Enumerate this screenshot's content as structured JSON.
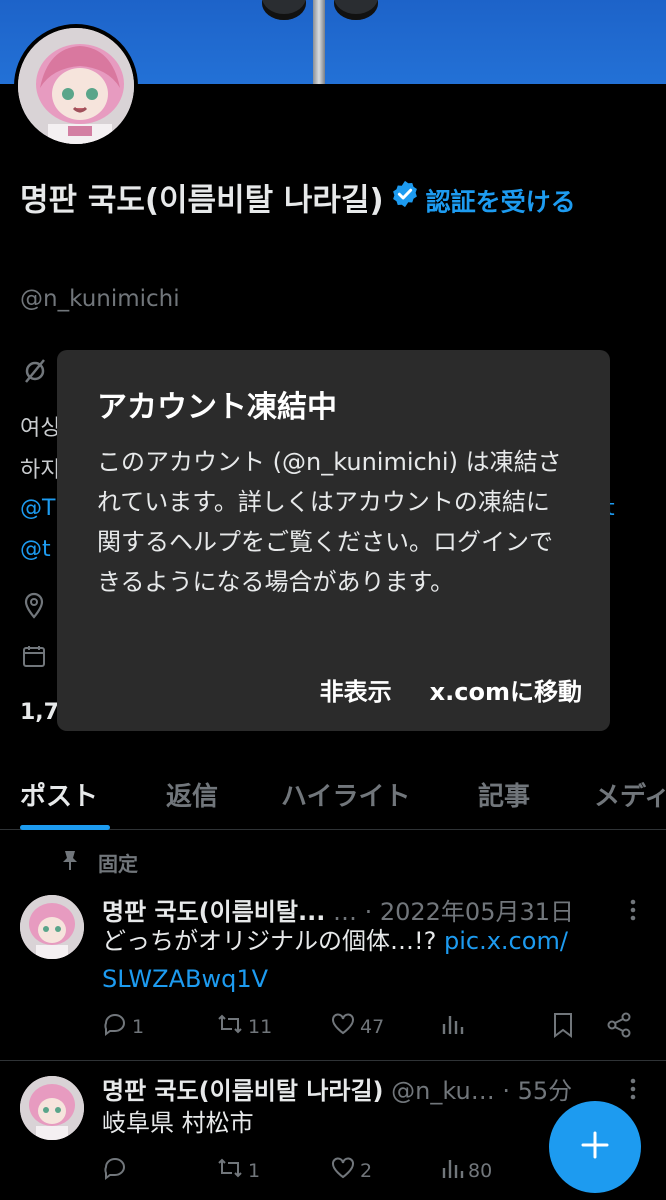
{
  "profile": {
    "display_name": "명판 국도(이름비탈 나라길)",
    "verify_link": "認証を受ける",
    "handle": "@n_kunimichi",
    "counts_fragment": "1,7",
    "bio_fragments": [
      "여싱",
      "하지"
    ],
    "link_fragments": [
      "@T",
      "@t",
      "t"
    ]
  },
  "dialog": {
    "title": "アカウント凍結中",
    "body": "このアカウント (@n_kunimichi) は凍結されています。詳しくはアカウントの凍結に関するヘルプをご覧ください。ログインできるようになる場合があります。",
    "hide_label": "非表示",
    "goto_label": "x.comに移動"
  },
  "tabs": [
    {
      "label": "ポスト",
      "active": true
    },
    {
      "label": "返信",
      "active": false
    },
    {
      "label": "ハイライト",
      "active": false
    },
    {
      "label": "記事",
      "active": false
    },
    {
      "label": "メディ",
      "active": false
    }
  ],
  "posts": [
    {
      "pinned_label": "固定",
      "name": "명판 국도(이름비탈...",
      "meta": " … · 2022年05月31日",
      "text": "どっちがオリジナルの個体…!? ",
      "link_line1": "pic.x.com/",
      "link_line2": "SLWZABwq1V",
      "replies": "1",
      "reposts": "11",
      "likes": "47",
      "views": ""
    },
    {
      "name": "명판 국도(이름비탈 나라길)",
      "meta": " @n_ku… · 55分",
      "text": "岐阜県 村松市",
      "replies": "",
      "reposts": "1",
      "likes": "2",
      "views": "80"
    }
  ],
  "colors": {
    "accent": "#1d9bf0",
    "background": "#000000",
    "dialog_bg": "#2b2b2b",
    "muted": "#71767b"
  },
  "icons": [
    "verified-badge-icon",
    "pin-icon",
    "location-icon",
    "calendar-icon",
    "link-icon",
    "reply-icon",
    "repost-icon",
    "like-icon",
    "views-icon",
    "bookmark-icon",
    "share-icon",
    "more-icon",
    "plus-icon"
  ]
}
